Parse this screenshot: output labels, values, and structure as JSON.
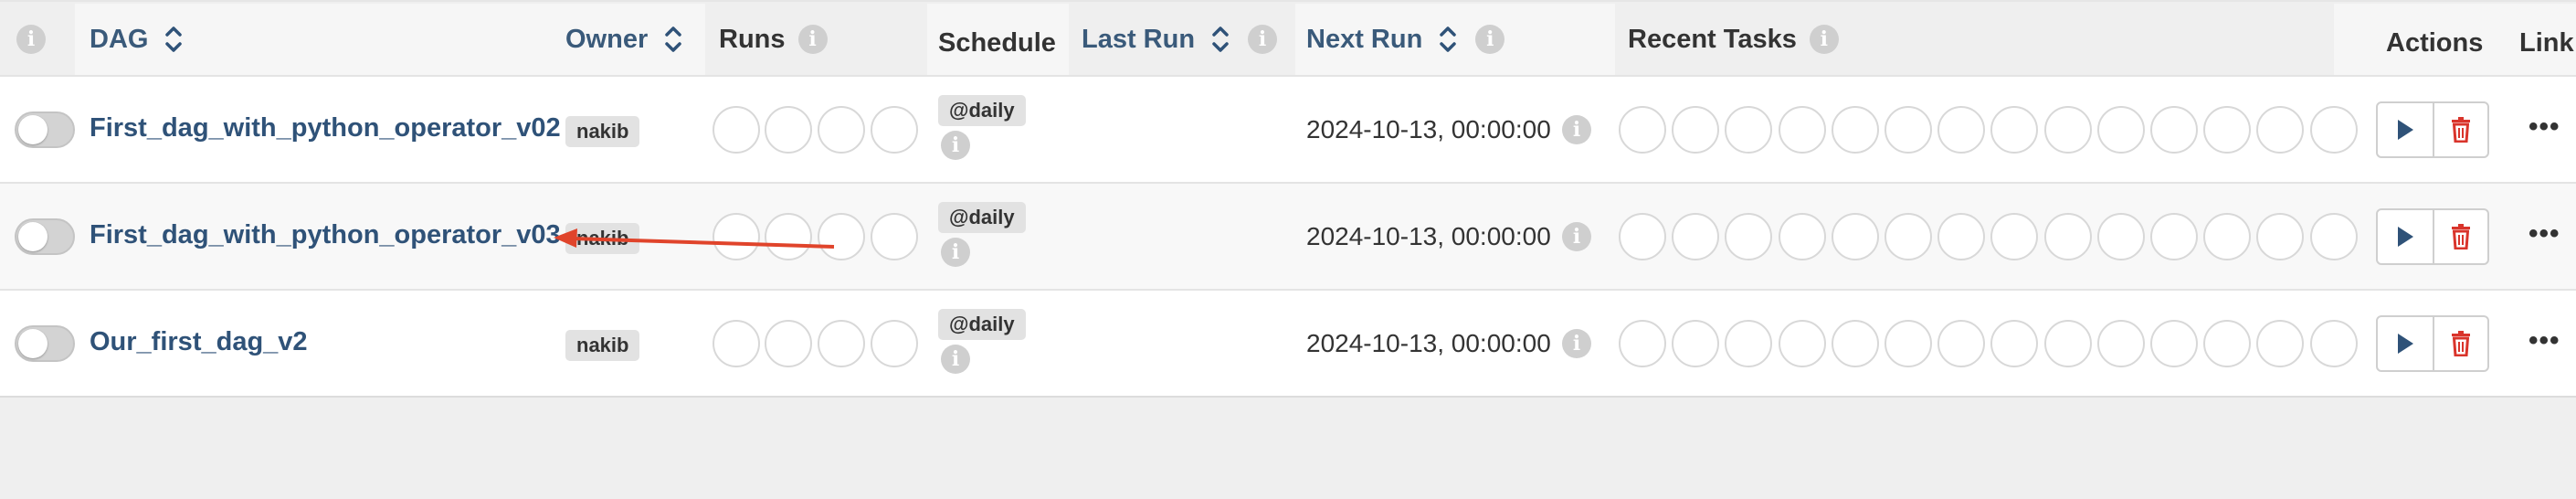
{
  "header": {
    "dag": "DAG",
    "owner": "Owner",
    "runs": "Runs",
    "schedule": "Schedule",
    "last_run": "Last Run",
    "next_run": "Next Run",
    "recent_tasks": "Recent Tasks",
    "actions": "Actions",
    "links": "Link"
  },
  "rows": [
    {
      "dag_id": "First_dag_with_python_operator_v02",
      "owner": "nakib",
      "schedule": "@daily",
      "next_run": "2024-10-13, 00:00:00"
    },
    {
      "dag_id": "First_dag_with_python_operator_v03",
      "owner": "nakib",
      "schedule": "@daily",
      "next_run": "2024-10-13, 00:00:00"
    },
    {
      "dag_id": "Our_first_dag_v2",
      "owner": "nakib",
      "schedule": "@daily",
      "next_run": "2024-10-13, 00:00:00"
    }
  ],
  "icons": {
    "info": "info-icon",
    "sort": "sort-icon",
    "trigger": "play-icon",
    "delete": "trash-icon",
    "more": "more-icon"
  },
  "colors": {
    "link": "#2f5278",
    "delete": "#d9342b",
    "trigger": "#2f5278",
    "annotation_arrow": "#e0442b"
  },
  "info_glyph": "i",
  "more_glyph": "•••"
}
